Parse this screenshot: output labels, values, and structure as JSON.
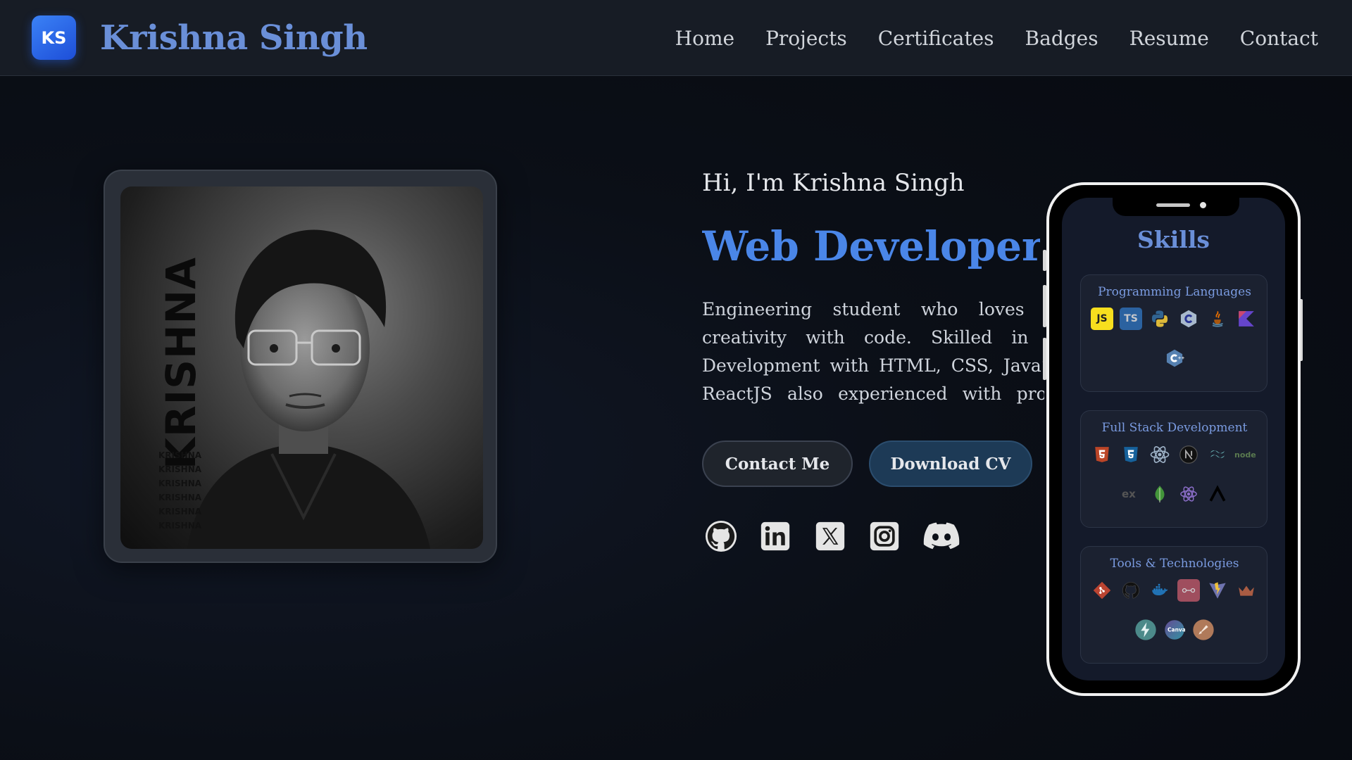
{
  "brand": {
    "logo_text": "KS",
    "name": "Krishna Singh"
  },
  "nav": {
    "items": [
      "Home",
      "Projects",
      "Certificates",
      "Badges",
      "Resume",
      "Contact"
    ]
  },
  "photo": {
    "overlay_text": "KRISHNA",
    "small_lines": [
      "KRISHNA",
      "KRISHNA",
      "KRISHNA",
      "KRISHNA",
      "KRISHNA",
      "KRISHNA"
    ]
  },
  "hero": {
    "greeting": "Hi, I'm Krishna Singh",
    "headline": "Web Developer &",
    "description": "Engineering student who loves combining creativity with code. Skilled in Front-End Development with HTML, CSS, JavaScript and ReactJS also experienced with programming languages like C, Python, Java and TypeScript.",
    "contact_button": "Contact Me",
    "cv_button": "Download CV"
  },
  "socials": [
    "github-icon",
    "linkedin-icon",
    "x-icon",
    "instagram-icon",
    "discord-icon"
  ],
  "skills": {
    "title": "Skills",
    "cards": [
      {
        "title": "Programming Languages",
        "icons": [
          "javascript-icon",
          "typescript-icon",
          "python-icon",
          "c-icon",
          "java-icon",
          "kotlin-icon",
          "cpp-icon"
        ]
      },
      {
        "title": "Full Stack Development",
        "icons": [
          "html5-icon",
          "css3-icon",
          "react-icon",
          "nextjs-icon",
          "tailwind-icon",
          "nodejs-icon",
          "express-icon",
          "mongodb-icon",
          "redux-icon",
          "vercel-icon"
        ]
      },
      {
        "title": "Tools & Technologies",
        "icons": [
          "git-icon",
          "github-icon",
          "docker-icon",
          "postman-icon",
          "vite-icon",
          "crown-icon",
          "thunder-client-icon",
          "canva-icon",
          "figma-icon"
        ]
      }
    ]
  },
  "colors": {
    "accent": "#4a86e8",
    "brand": "#6a8fd8",
    "navbar": "#171c25",
    "background": "#0b0f17"
  }
}
